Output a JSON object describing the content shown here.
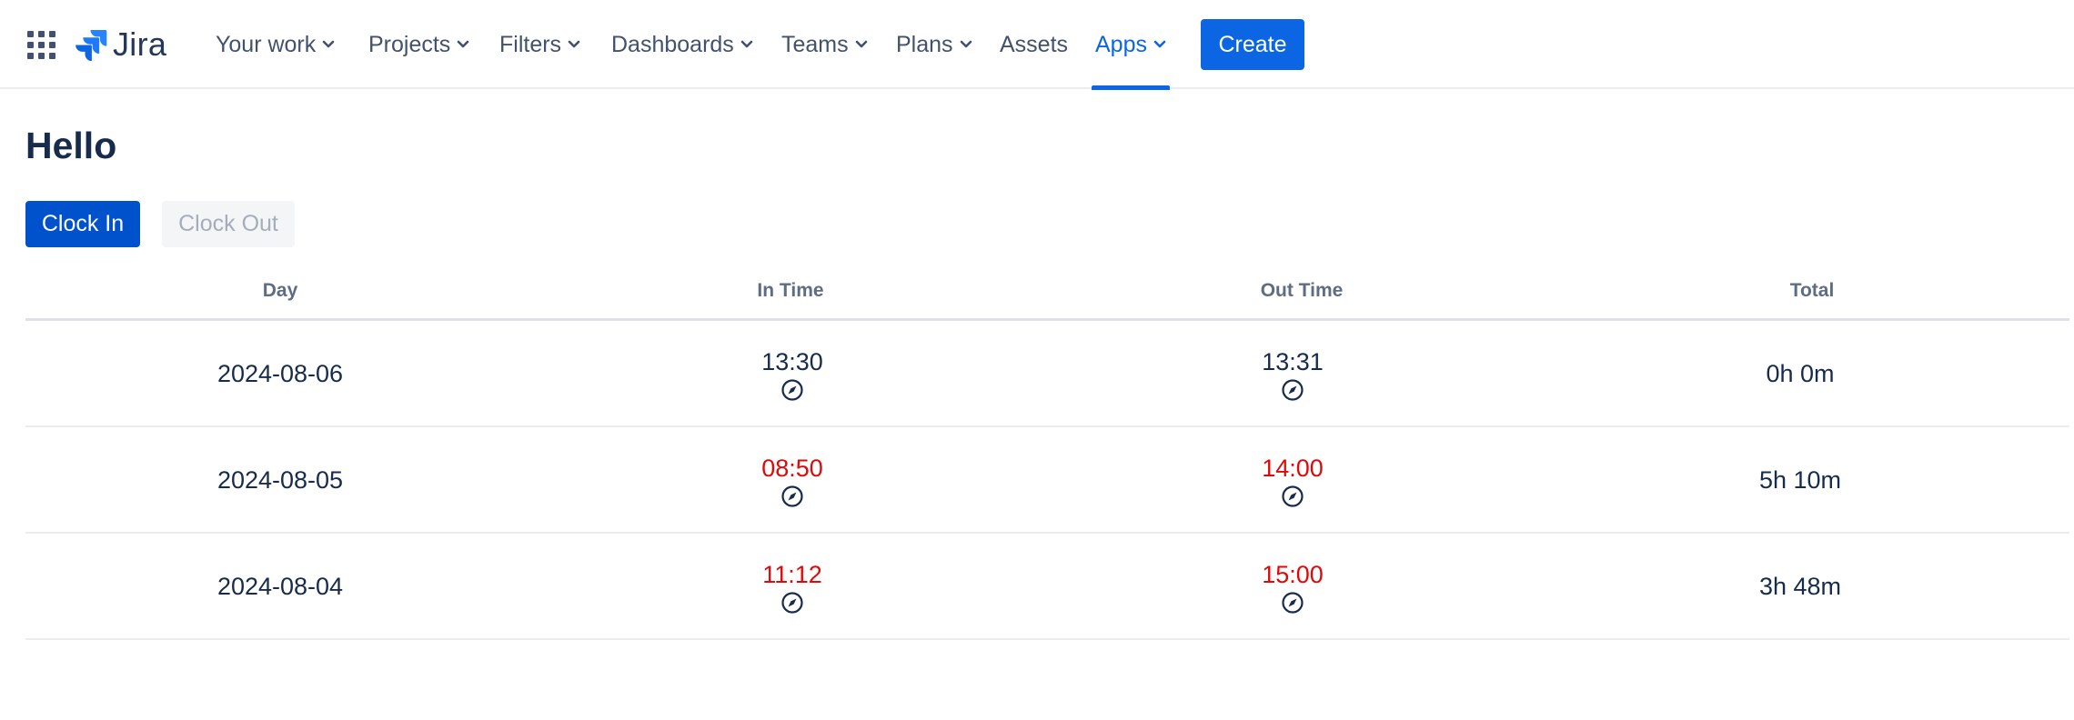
{
  "app": {
    "name": "Jira"
  },
  "nav": {
    "items": [
      {
        "label": "Your work",
        "dropdown": true
      },
      {
        "label": "Projects",
        "dropdown": true
      },
      {
        "label": "Filters",
        "dropdown": true
      },
      {
        "label": "Dashboards",
        "dropdown": true
      },
      {
        "label": "Teams",
        "dropdown": true
      },
      {
        "label": "Plans",
        "dropdown": true
      },
      {
        "label": "Assets",
        "dropdown": false
      },
      {
        "label": "Apps",
        "dropdown": true,
        "active": true
      }
    ],
    "create_label": "Create"
  },
  "page": {
    "title": "Hello",
    "clock_in_label": "Clock In",
    "clock_out_label": "Clock Out",
    "clock_out_disabled": true
  },
  "table": {
    "headers": [
      "Day",
      "In Time",
      "Out Time",
      "Total"
    ],
    "rows": [
      {
        "day": "2024-08-06",
        "in_time": "13:30",
        "in_warn": false,
        "out_time": "13:31",
        "out_warn": false,
        "total": "0h 0m"
      },
      {
        "day": "2024-08-05",
        "in_time": "08:50",
        "in_warn": true,
        "out_time": "14:00",
        "out_warn": true,
        "total": "5h 10m"
      },
      {
        "day": "2024-08-04",
        "in_time": "11:12",
        "in_warn": true,
        "out_time": "15:00",
        "out_warn": true,
        "total": "3h 48m"
      }
    ]
  },
  "colors": {
    "accent": "#0c66e4",
    "primary_button": "#0052cc",
    "warning_text": "#de0a0a",
    "text": "#172b4d",
    "nav_text": "#42526e"
  },
  "icons": {
    "app_switcher": "grid-icon",
    "logo": "jira-logo-icon",
    "dropdown": "chevron-down-icon",
    "location": "compass-icon"
  }
}
